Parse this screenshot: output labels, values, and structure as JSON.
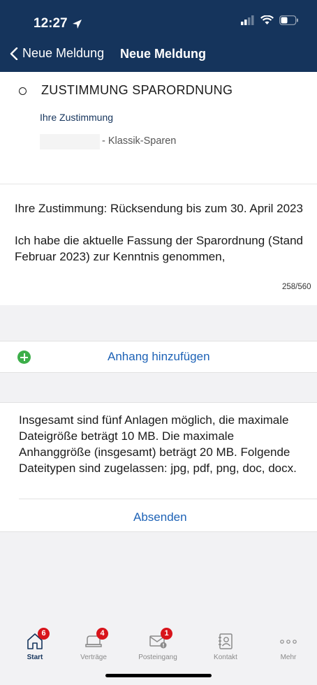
{
  "status_bar": {
    "time": "12:27"
  },
  "nav": {
    "back_label": "Neue Meldung",
    "title": "Neue Meldung"
  },
  "section": {
    "title": "ZUSTIMMUNG SPARORDNUNG",
    "sub_label": "Ihre Zustimmung",
    "product": "- Klassik-Sparen"
  },
  "message": {
    "line1": "Ihre Zustimmung: Rücksendung bis zum 30. April 2023",
    "line2": "Ich habe die aktuelle Fassung der Sparordnung (Stand Februar 2023) zur Kenntnis genommen,",
    "counter": "258/560"
  },
  "attachment": {
    "add_label": "Anhang hinzufügen"
  },
  "info": {
    "text": "Insgesamt sind fünf Anlagen möglich, die maximale Dateigröße beträgt 10 MB. Die maximale Anhanggröße (insgesamt) beträgt 20 MB. Folgende Dateitypen sind zugelassen: jpg, pdf, png, doc, docx.",
    "send_label": "Absenden"
  },
  "tabs": [
    {
      "label": "Start",
      "badge": "6",
      "icon": "home-icon"
    },
    {
      "label": "Verträge",
      "badge": "4",
      "icon": "contracts-icon"
    },
    {
      "label": "Posteingang",
      "badge": "1",
      "icon": "mail-icon"
    },
    {
      "label": "Kontakt",
      "badge": "",
      "icon": "contact-book-icon"
    },
    {
      "label": "Mehr",
      "badge": "",
      "icon": "more-icon"
    }
  ],
  "colors": {
    "header": "#15345c",
    "link": "#1d62b6",
    "badge": "#d8141b",
    "add": "#3cae49"
  }
}
